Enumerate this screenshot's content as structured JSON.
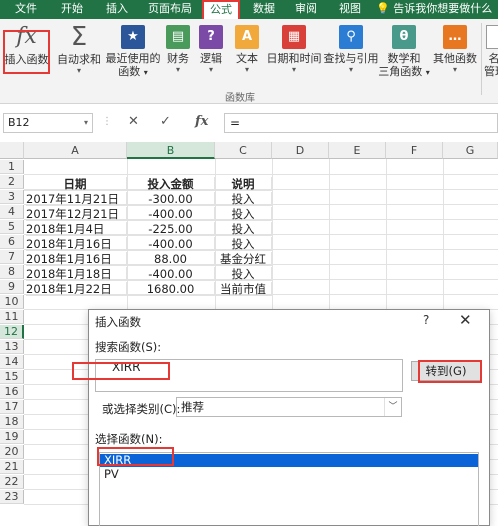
{
  "ribbon_tabs": [
    "文件",
    "开始",
    "插入",
    "页面布局",
    "公式",
    "数据",
    "审阅",
    "视图"
  ],
  "active_tab": "公式",
  "tell_me": "告诉我你想要做什么",
  "ribbon": {
    "insert_function": "插入函数",
    "autosum": "自动求和",
    "recent_1": "最近使用的",
    "recent_2": "函数",
    "financial": "财务",
    "logical": "逻辑",
    "text": "文本",
    "datetime": "日期和时间",
    "lookup": "查找与引用",
    "math_1": "数学和",
    "math_2": "三角函数",
    "other": "其他函数",
    "name_mgr_1": "名",
    "name_mgr_2": "管理",
    "group_label": "函数库"
  },
  "formula_bar": {
    "name_box": "B12",
    "cancel": "✕",
    "enter": "✓",
    "fx": "fx",
    "formula": "="
  },
  "columns": [
    "A",
    "B",
    "C",
    "D",
    "E",
    "F",
    "G"
  ],
  "rows": [
    "1",
    "2",
    "3",
    "4",
    "5",
    "6",
    "7",
    "8",
    "9",
    "10",
    "11",
    "12",
    "13",
    "14",
    "15",
    "16",
    "17",
    "18",
    "19",
    "20",
    "21",
    "22",
    "23"
  ],
  "cells": {
    "headers": [
      "日期",
      "投入金额",
      "说明"
    ],
    "data": [
      [
        "2017年11月21日",
        "-300.00",
        "投入"
      ],
      [
        "2017年12月21日",
        "-400.00",
        "投入"
      ],
      [
        "2018年1月4日",
        "-225.00",
        "投入"
      ],
      [
        "2018年1月16日",
        "-400.00",
        "投入"
      ],
      [
        "2018年1月16日",
        "88.00",
        "基金分红"
      ],
      [
        "2018年1月18日",
        "-400.00",
        "投入"
      ],
      [
        "2018年1月22日",
        "1680.00",
        "当前市值"
      ]
    ]
  },
  "dialog": {
    "title": "插入函数",
    "help": "?",
    "close": "✕",
    "search_label": "搜索函数(S):",
    "search_value": "XIRR",
    "goto_button": "转到(G)",
    "category_label": "或选择类别(C):",
    "category_value": "推荐",
    "select_label": "选择函数(N):",
    "functions": [
      "XIRR",
      "PV"
    ]
  }
}
